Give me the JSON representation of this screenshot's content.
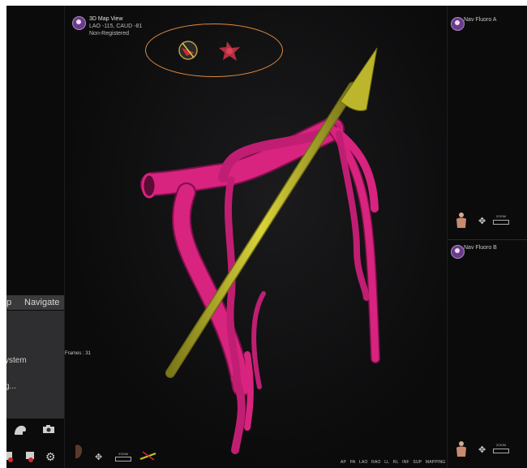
{
  "main_view": {
    "title": "3D Map View",
    "angle": "LAO -115, CAUD -81",
    "registration": "Non-Registered",
    "frames_label": "Frames : 31",
    "zoom_label": "ZOOM",
    "view_buttons": [
      "AP",
      "PA",
      "LAO",
      "RAO",
      "LL",
      "RL",
      "INF",
      "SUP",
      "MAPPING"
    ]
  },
  "left_panel": {
    "tabs": [
      "ap",
      "Navigate"
    ],
    "text_lines": [
      "ystem",
      "g..."
    ]
  },
  "nav_fluoro_a": {
    "title": "Nav Fluoro A",
    "zoom_label": "ZOOM"
  },
  "nav_fluoro_b": {
    "title": "Nav Fluoro B",
    "zoom_label": "ZOOM"
  },
  "colors": {
    "vessel": "#d8237f",
    "arrow": "#c9c32a",
    "highlight_oval": "#e08a3a",
    "badge": "#6b3a8c"
  }
}
